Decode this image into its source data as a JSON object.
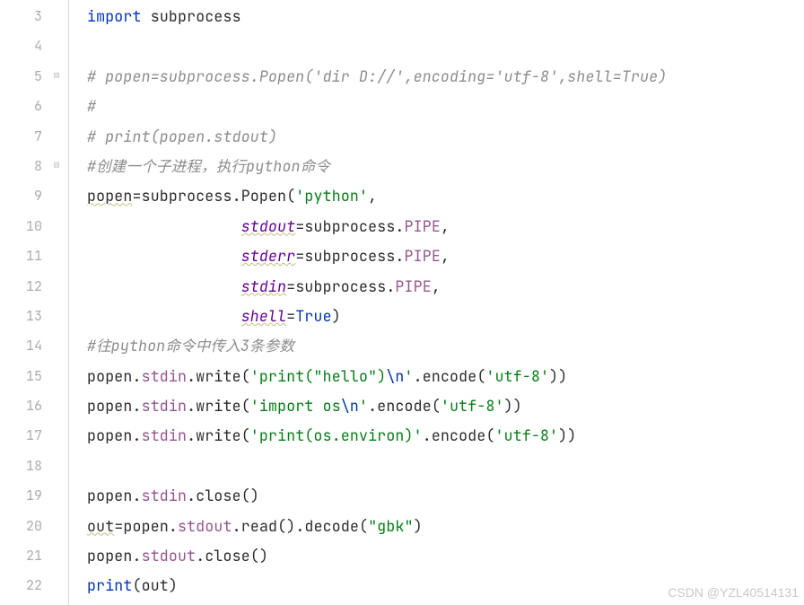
{
  "watermark": "CSDN @YZL40514131",
  "lines": {
    "start": 3,
    "end": 22
  },
  "code": {
    "l3": {
      "kw": "import",
      "mod": "subprocess"
    },
    "l5": {
      "comment": "# popen=subprocess.Popen('dir D://',encoding='utf-8',shell=True)"
    },
    "l6": {
      "comment": "#"
    },
    "l7": {
      "comment": "# print(popen.stdout)"
    },
    "l8": {
      "comment": "#创建一个子进程，执行python命令"
    },
    "l9": {
      "lhs": "popen",
      "eq": "=",
      "mod": "subprocess",
      "dot": ".",
      "cls": "Popen",
      "lp": "(",
      "arg": "'python'",
      "comma": ","
    },
    "l10": {
      "indent": "                 ",
      "param": "stdout",
      "eq": "=",
      "mod": "subprocess",
      "dot": ".",
      "attr": "PIPE",
      "comma": ","
    },
    "l11": {
      "indent": "                 ",
      "param": "stderr",
      "eq": "=",
      "mod": "subprocess",
      "dot": ".",
      "attr": "PIPE",
      "comma": ","
    },
    "l12": {
      "indent": "                 ",
      "param": "stdin",
      "eq": "=",
      "mod": "subprocess",
      "dot": ".",
      "attr": "PIPE",
      "comma": ","
    },
    "l13": {
      "indent": "                 ",
      "param": "shell",
      "eq": "=",
      "val": "True",
      "rp": ")"
    },
    "l14": {
      "comment": "#往python命令中传入3条参数"
    },
    "l15": {
      "obj": "popen",
      "d1": ".",
      "a1": "stdin",
      "d2": ".",
      "fn": "write",
      "lp": "(",
      "s1": "'print(\"hello\")",
      "esc": "\\n",
      "s2": "'",
      "d3": ".",
      "enc": "encode",
      "lp2": "(",
      "arg": "'utf-8'",
      "rp2": ")",
      "rp": ")"
    },
    "l16": {
      "obj": "popen",
      "d1": ".",
      "a1": "stdin",
      "d2": ".",
      "fn": "write",
      "lp": "(",
      "s1": "'import os",
      "esc": "\\n",
      "s2": "'",
      "d3": ".",
      "enc": "encode",
      "lp2": "(",
      "arg": "'utf-8'",
      "rp2": ")",
      "rp": ")"
    },
    "l17": {
      "obj": "popen",
      "d1": ".",
      "a1": "stdin",
      "d2": ".",
      "fn": "write",
      "lp": "(",
      "s1": "'print(os.environ)'",
      "d3": ".",
      "enc": "encode",
      "lp2": "(",
      "arg": "'utf-8'",
      "rp2": ")",
      "rp": ")"
    },
    "l19": {
      "obj": "popen",
      "d1": ".",
      "a1": "stdin",
      "d2": ".",
      "fn": "close",
      "lp": "(",
      "rp": ")"
    },
    "l20": {
      "lhs": "out",
      "eq": "=",
      "obj": "popen",
      "d1": ".",
      "a1": "stdout",
      "d2": ".",
      "fn": "read",
      "lp": "(",
      "rp": ")",
      "d3": ".",
      "dec": "decode",
      "lp2": "(",
      "arg": "\"gbk\"",
      "rp2": ")"
    },
    "l21": {
      "obj": "popen",
      "d1": ".",
      "a1": "stdout",
      "d2": ".",
      "fn": "close",
      "lp": "(",
      "rp": ")"
    },
    "l22": {
      "fn": "print",
      "lp": "(",
      "arg": "out",
      "rp": ")"
    }
  }
}
